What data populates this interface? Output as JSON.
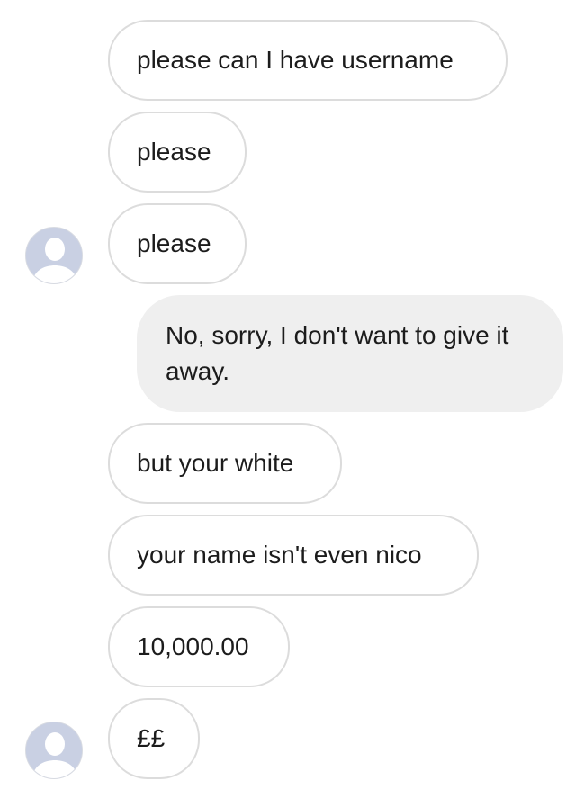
{
  "messages": [
    {
      "text": "please can I have username"
    },
    {
      "text": "please"
    },
    {
      "text": "please"
    },
    {
      "text": "No, sorry, I don't want to give it away."
    },
    {
      "text": "but your white"
    },
    {
      "text": "your name isn't even nico"
    },
    {
      "text": "10,000.00"
    },
    {
      "text": "££"
    }
  ],
  "avatar": {
    "icon": "default-user-silhouette",
    "color": "#c9d0e3"
  }
}
